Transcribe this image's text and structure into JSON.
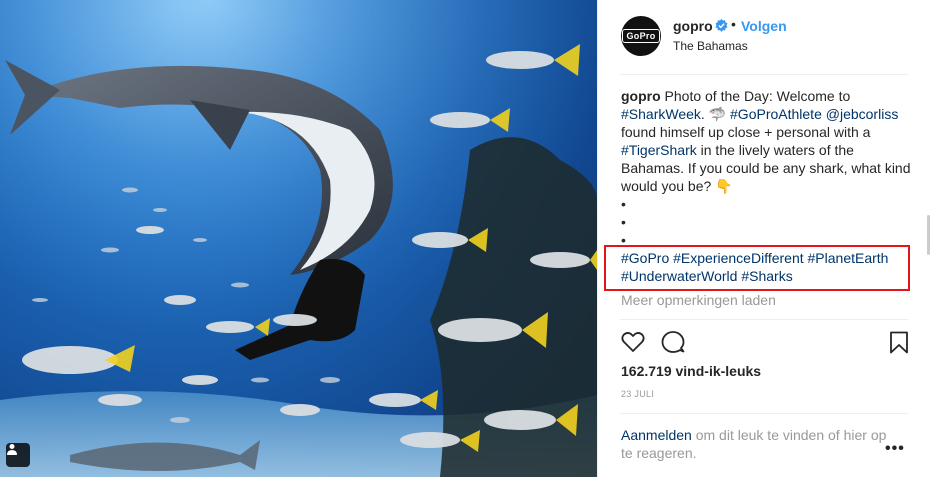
{
  "post": {
    "username": "gopro",
    "verified": true,
    "separator": "•",
    "follow_label": "Volgen",
    "location": "The Bahamas",
    "avatar_label": "GoPro"
  },
  "caption": {
    "username": "gopro",
    "t1": " Photo of the Day: Welcome to ",
    "tag_sharkweek": "#SharkWeek",
    "t2": ". 🦈 ",
    "tag_goproathlete": "#GoProAthlete",
    "t3": " ",
    "mention": "@jebcorliss",
    "t4": " found himself up close + personal with a ",
    "tag_tigershark": "#TigerShark",
    "t5": " in the lively waters of the Bahamas. If you could be any shark, what kind would you be? 👇",
    "bullets": [
      "•",
      "•",
      "•"
    ],
    "hashtags_line1": [
      "#GoPro",
      "#ExperienceDifferent",
      "#PlanetEarth"
    ],
    "hashtags_line2": [
      "#UnderwaterWorld",
      "#Sharks"
    ]
  },
  "load_more": "Meer opmerkingen laden",
  "actions": {
    "like_icon": "heart-outline-icon",
    "comment_icon": "comment-bubble-icon",
    "save_icon": "bookmark-icon"
  },
  "likes": "162.719 vind-ik-leuks",
  "date": "23 JULI",
  "login_prompt": {
    "link": "Aanmelden",
    "text": " om dit leuk te vinden of hier op te reageren."
  },
  "more_options": "•••",
  "colors": {
    "link": "#003569",
    "follow": "#3897f0",
    "highlight": "#e3151a",
    "muted": "#999999"
  }
}
